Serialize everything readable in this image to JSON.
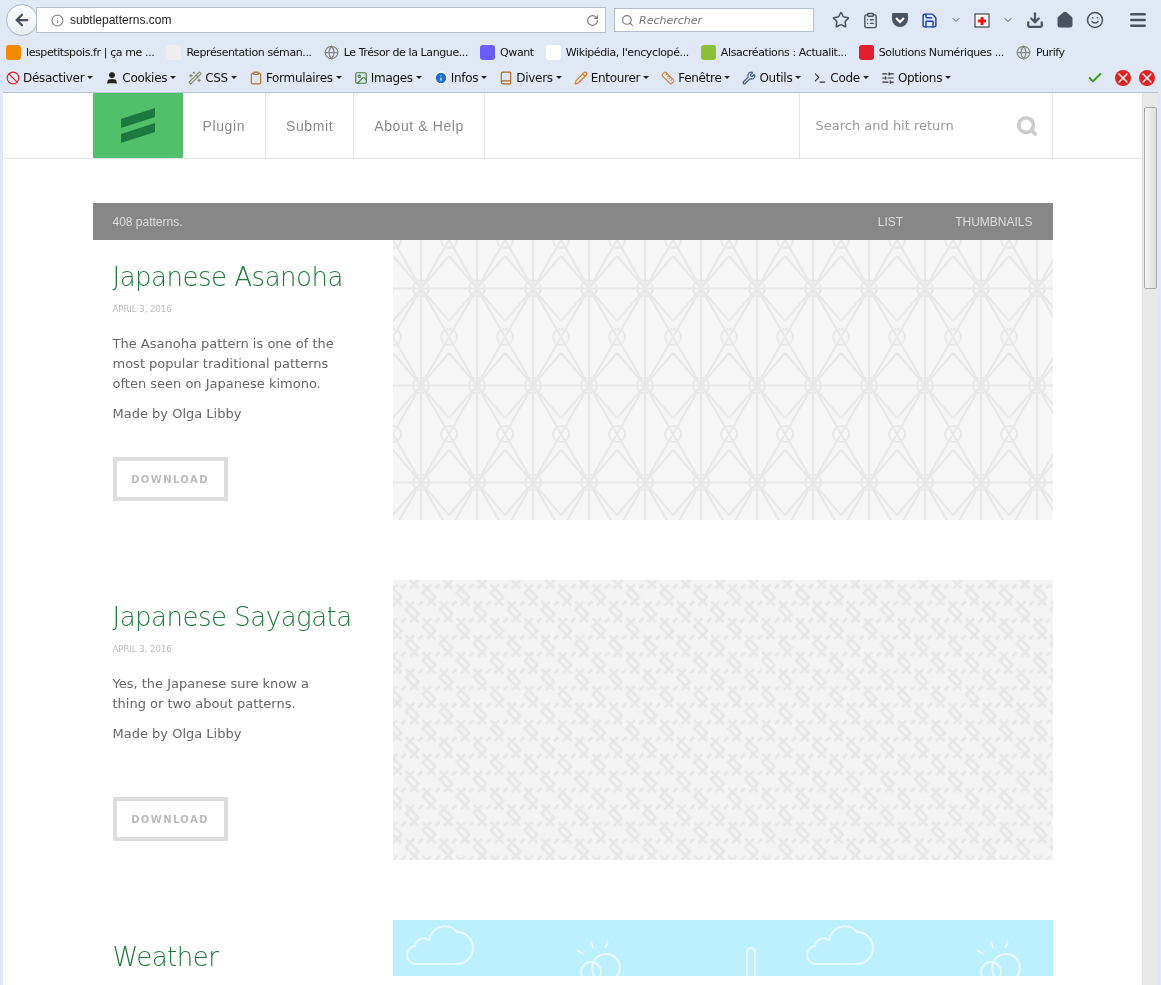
{
  "browser": {
    "url": "subtlepatterns.com",
    "search_placeholder": "Rechercher",
    "bookmarks": [
      {
        "label": "lespetitspois.fr | ça me ...",
        "kind": "lpp"
      },
      {
        "label": "Représentation séman...",
        "kind": "graph"
      },
      {
        "label": "Le Trésor de la Langue...",
        "kind": "globe"
      },
      {
        "label": "Qwant",
        "kind": "qwant"
      },
      {
        "label": "Wikipédia, l'encyclopé...",
        "kind": "wiki"
      },
      {
        "label": "Alsacréations : Actualit...",
        "kind": "alsa"
      },
      {
        "label": "Solutions Numériques ...",
        "kind": "sl"
      },
      {
        "label": "Purify",
        "kind": "globe"
      }
    ],
    "devtools": [
      {
        "label": "Désactiver",
        "kind": "disable"
      },
      {
        "label": "Cookies",
        "kind": "cookie"
      },
      {
        "label": "CSS",
        "kind": "css"
      },
      {
        "label": "Formulaires",
        "kind": "form"
      },
      {
        "label": "Images",
        "kind": "image"
      },
      {
        "label": "Infos",
        "kind": "info"
      },
      {
        "label": "Divers",
        "kind": "misc"
      },
      {
        "label": "Entourer",
        "kind": "pencil"
      },
      {
        "label": "Fenêtre",
        "kind": "ruler"
      },
      {
        "label": "Outils",
        "kind": "tools"
      },
      {
        "label": "Code",
        "kind": "code"
      },
      {
        "label": "Options",
        "kind": "options"
      }
    ]
  },
  "site": {
    "nav": [
      "Plugin",
      "Submit",
      "About & Help"
    ],
    "search_placeholder": "Search and hit return",
    "count": "408 patterns.",
    "views": [
      "LIST",
      "THUMBNAILS"
    ],
    "patterns": [
      {
        "title": "Japanese Asanoha",
        "date": "APRIL 3, 2016",
        "description": "The Asanoha pattern is one of the most popular traditional patterns often seen on Japanese kimono.",
        "author": "Made by Olga Libby",
        "button": "DOWNLOAD",
        "kind": "asanoha"
      },
      {
        "title": "Japanese Sayagata",
        "date": "APRIL 3, 2016",
        "description": "Yes, the Japanese sure know a thing or two about patterns.",
        "author": "Made by Olga Libby",
        "button": "DOWNLOAD",
        "kind": "sayagata"
      },
      {
        "title": "Weather",
        "kind": "weather"
      }
    ]
  }
}
